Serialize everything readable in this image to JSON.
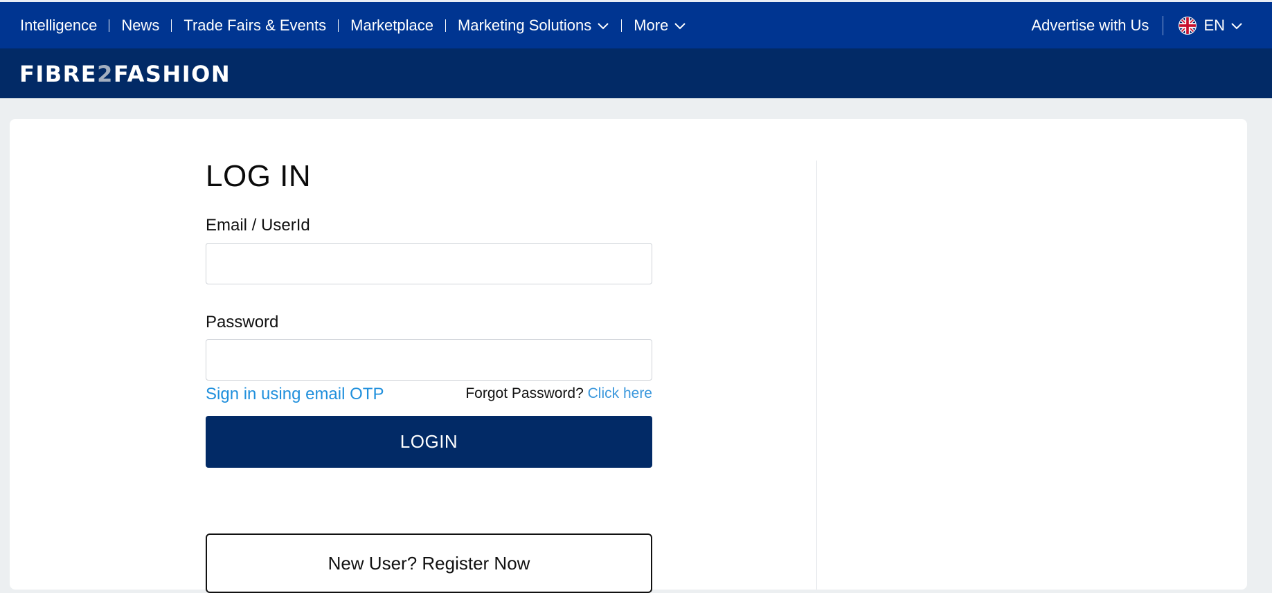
{
  "topnav": {
    "items": [
      {
        "label": "Intelligence",
        "dropdown": false
      },
      {
        "label": "News",
        "dropdown": false
      },
      {
        "label": "Trade Fairs & Events",
        "dropdown": false
      },
      {
        "label": "Marketplace",
        "dropdown": false
      },
      {
        "label": "Marketing Solutions",
        "dropdown": true
      },
      {
        "label": "More",
        "dropdown": true
      }
    ],
    "advertise": "Advertise with Us",
    "language": "EN"
  },
  "brand": {
    "logo_part1": "FIBRE",
    "logo_part2": "2",
    "logo_part3": "FASHION"
  },
  "login": {
    "title": "LOG IN",
    "email_label": "Email / UserId",
    "email_value": "",
    "password_label": "Password",
    "password_value": "",
    "otp_link": "Sign in using email OTP",
    "forgot_text": "Forgot Password?",
    "forgot_link": "Click here",
    "login_button": "LOGIN",
    "register_button": "New User? Register Now"
  },
  "colors": {
    "topnav_bg": "#003591",
    "brandbar_bg": "#022a66",
    "link": "#1f8fdc",
    "page_bg": "#eceff1"
  },
  "icons": {
    "chevron": "chevron-down-icon",
    "flag": "uk-flag-icon"
  }
}
